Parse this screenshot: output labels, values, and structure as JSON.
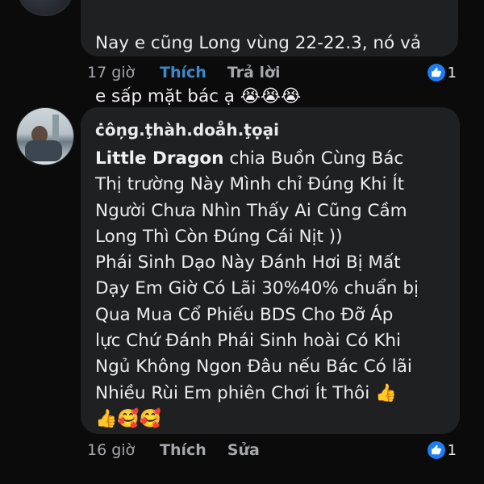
{
  "comments": [
    {
      "text_lines": [
        "Nay e cũng Long vùng 22-22.3, nó vả",
        "e sấp mặt bác ạ 😭😭😭"
      ],
      "time": "17 giờ",
      "like_label": "Thích",
      "reply_label": "Trả lời",
      "reaction_count": "1"
    },
    {
      "author": "ċôņɡ.ţhàh.doåh.ţọại",
      "mention": "Little Dragon",
      "text_lines": [
        "  chia Buồn Cùng Bác",
        "Thị trường Này Mình chỉ Đúng Khi Ít",
        "Người Chưa Nhìn Thấy Ai Cũng Cầm",
        "Long Thì Còn Đúng Cái Nịt ))",
        "Phái Sinh Dạo Này Đánh Hơi Bị Mất",
        "Dạy Em Giờ Có Lãi 30%40% chuẩn bị",
        "Qua Mua Cổ Phiếu BDS Cho Đỡ Áp",
        "lực Chứ Đánh Phái Sinh hoài Có Khi",
        "Ngủ Không Ngon Đâu nếu Bác Có lãi",
        "Nhiều Rùi Em phiên Chơi Ít Thôi 👍",
        "👍🥰🥰"
      ],
      "time": "16 giờ",
      "like_label": "Thích",
      "reply_label": "Sửa",
      "reaction_count": "1"
    }
  ],
  "colors": {
    "background": "#0b0b0c",
    "bubble": "#1f2022",
    "like_active": "#3a8bc9",
    "reaction_badge": "#1c7df0"
  },
  "icons": {
    "reaction": "thumbs-up-icon"
  }
}
